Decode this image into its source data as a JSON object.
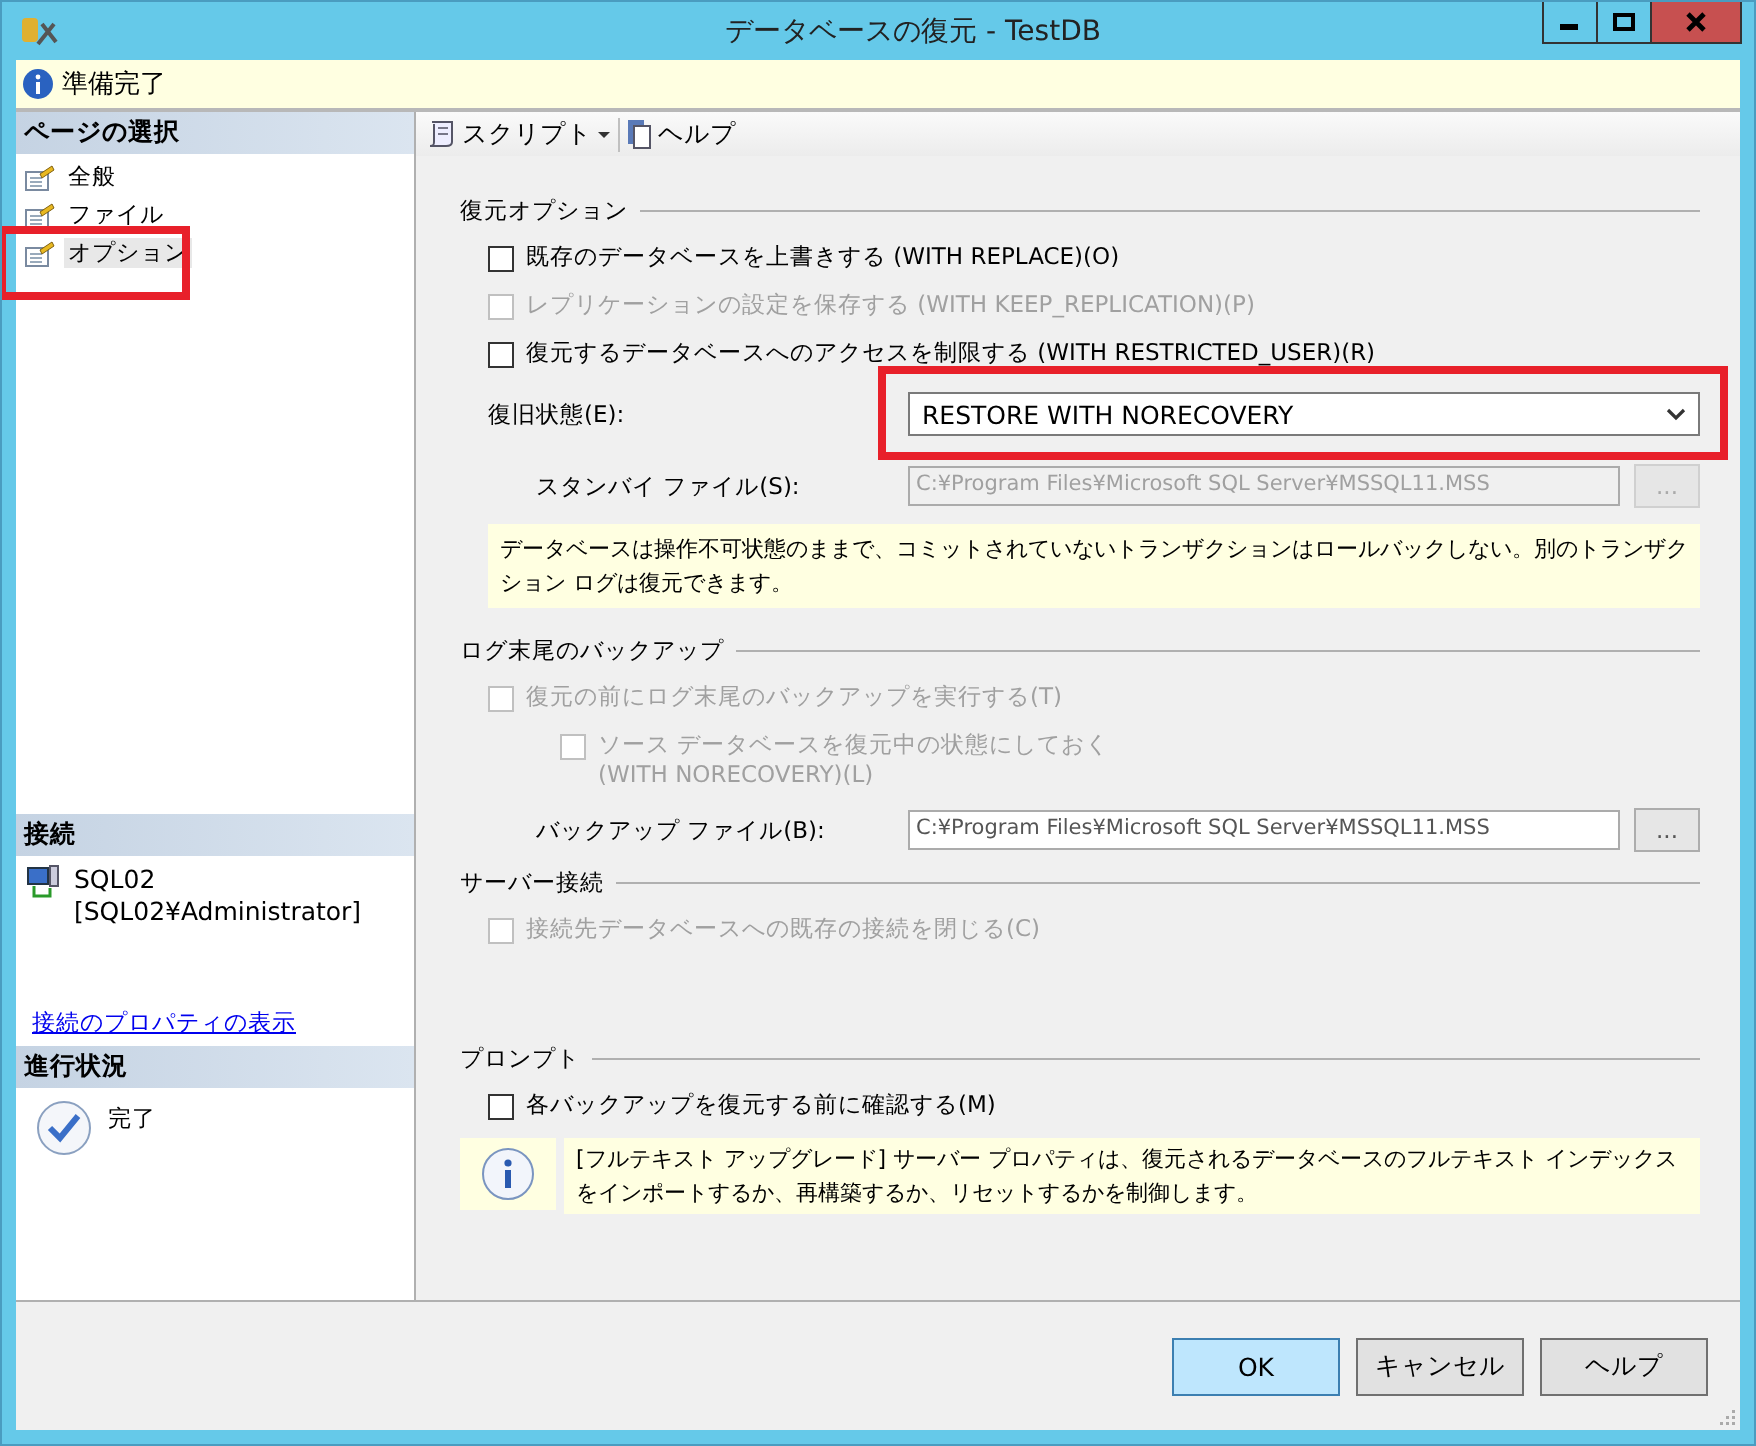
{
  "window": {
    "title": "データベースの復元 - TestDB"
  },
  "status": {
    "text": "準備完了"
  },
  "sidebar": {
    "header": "ページの選択",
    "items": [
      {
        "label": "全般",
        "selected": false,
        "highlighted": false
      },
      {
        "label": "ファイル",
        "selected": false,
        "highlighted": false
      },
      {
        "label": "オプション",
        "selected": true,
        "highlighted": true
      }
    ]
  },
  "connection": {
    "header": "接続",
    "server": "SQL02",
    "user": "[SQL02¥Administrator]",
    "link": "接続のプロパティの表示"
  },
  "progress": {
    "header": "進行状況",
    "status": "完了"
  },
  "toolbar": [
    {
      "kind": "script",
      "label": "スクリプト"
    },
    {
      "kind": "help",
      "label": "ヘルプ"
    }
  ],
  "sections": [
    {
      "title": "復元オプション",
      "rows": [
        {
          "kind": "checkbox",
          "label": "既存のデータベースを上書きする (WITH REPLACE)(O)",
          "checked": false,
          "disabled": false
        },
        {
          "kind": "checkbox",
          "label": "レプリケーションの設定を保存する (WITH KEEP_REPLICATION)(P)",
          "checked": false,
          "disabled": true
        },
        {
          "kind": "checkbox",
          "label": "復元するデータベースへのアクセスを制限する (WITH RESTRICTED_USER)(R)",
          "checked": false,
          "disabled": false
        },
        {
          "kind": "select",
          "label": "復旧状態(E):",
          "value": "RESTORE WITH NORECOVERY",
          "highlighted": true
        },
        {
          "kind": "file",
          "label": "スタンバイ ファイル(S):",
          "value": "C:¥Program Files¥Microsoft SQL Server¥MSSQL11.MSS",
          "button": "...",
          "disabled": true
        },
        {
          "kind": "note",
          "text": "データベースは操作不可状態のままで、コミットされていないトランザクションはロールバックしない。別のトランザクション ログは復元できます。"
        }
      ]
    },
    {
      "title": "ログ末尾のバックアップ",
      "rows": [
        {
          "kind": "checkbox",
          "label": "復元の前にログ末尾のバックアップを実行する(T)",
          "checked": false,
          "disabled": true,
          "children": [
            {
              "kind": "checkbox",
              "label": "ソース データベースを復元中の状態にしておく\n(WITH NORECOVERY)(L)",
              "checked": false,
              "disabled": true
            }
          ]
        },
        {
          "kind": "file",
          "label": "バックアップ ファイル(B):",
          "value": "C:¥Program Files¥Microsoft SQL Server¥MSSQL11.MSS",
          "button": "...",
          "disabled": false
        }
      ]
    },
    {
      "title": "サーバー接続",
      "rows": [
        {
          "kind": "checkbox",
          "label": "接続先データベースへの既存の接続を閉じる(C)",
          "checked": false,
          "disabled": true
        }
      ]
    },
    {
      "title": "プロンプト",
      "rows": [
        {
          "kind": "checkbox",
          "label": "各バックアップを復元する前に確認する(M)",
          "checked": false,
          "disabled": false
        },
        {
          "kind": "info",
          "text": "[フルテキスト アップグレード] サーバー プロパティは、復元されるデータベースのフルテキスト インデックスをインポートするか、再構築するか、リセットするかを制御します。"
        }
      ]
    }
  ],
  "buttons": [
    {
      "label": "OK",
      "default": true
    },
    {
      "label": "キャンセル",
      "default": false
    },
    {
      "label": "ヘルプ",
      "default": false
    }
  ]
}
